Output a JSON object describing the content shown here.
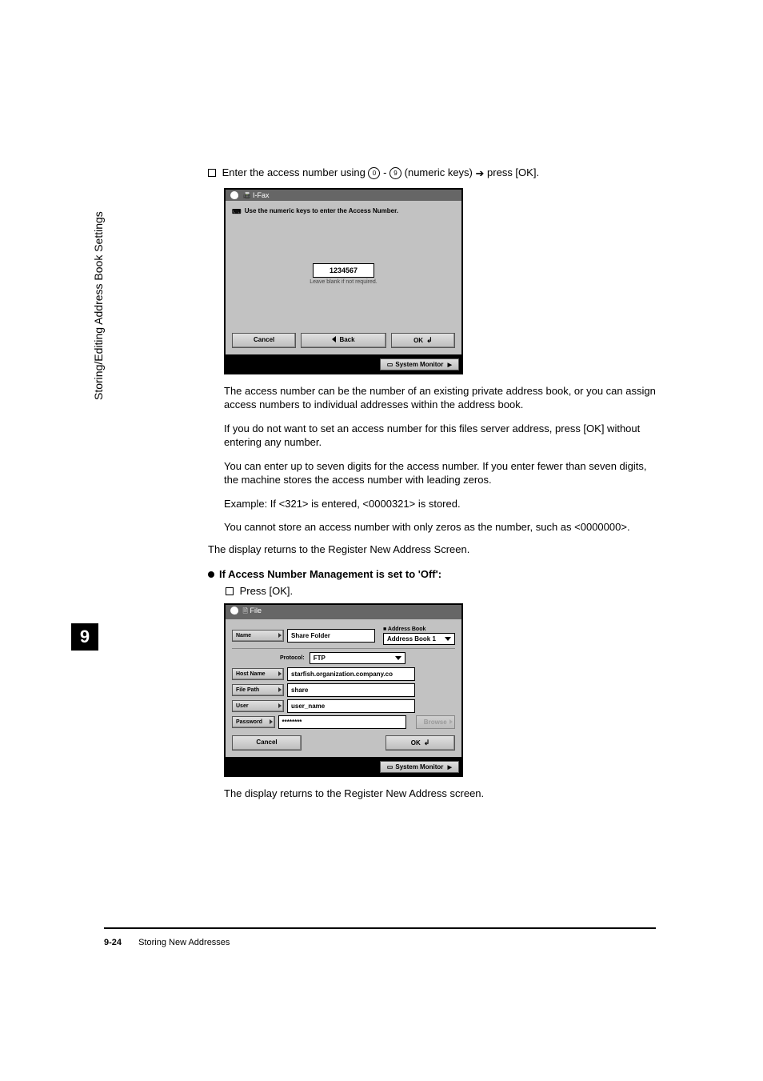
{
  "sideTab": "Storing/Editing Address Book Settings",
  "chapterNumber": "9",
  "intro": {
    "prefix": "Enter the access number using ",
    "key0": "0",
    "key9": "9",
    "mid": " (numeric keys) ",
    "suffix": " press [OK]."
  },
  "ss1": {
    "title": "I-Fax",
    "instruction": "Use the numeric keys to enter the Access Number.",
    "value": "1234567",
    "note": "Leave blank if not required.",
    "cancel": "Cancel",
    "back": "Back",
    "ok": "OK",
    "sysMonitor": "System Monitor"
  },
  "paras": {
    "p1": "The access number can be the number of an existing private address book, or you can assign access numbers to individual addresses within the address book.",
    "p2": "If you do not want to set an access number for this files server address, press [OK] without entering any number.",
    "p3": "You can enter up to seven digits for the access number. If you enter fewer than seven digits, the machine stores the access number with leading zeros.",
    "p4": "Example: If <321> is entered, <0000321> is stored.",
    "p5": "You cannot store an access number with only zeros as the number, such as <0000000>.",
    "p6": "The display returns to the Register New Address Screen."
  },
  "section2": {
    "heading": "If Access Number Management is set to 'Off':",
    "pressOk": "Press [OK]."
  },
  "ss2": {
    "title": "File",
    "nameLabel": "Name",
    "nameValue": "Share Folder",
    "abLabel": "Address Book",
    "abValue": "Address Book 1",
    "protocolLabel": "Protocol:",
    "protocolValue": "FTP",
    "hostLabel": "Host Name",
    "hostValue": "starfish.organization.company.co",
    "pathLabel": "File Path",
    "pathValue": "share",
    "userLabel": "User",
    "userValue": "user_name",
    "pwdLabel": "Password",
    "pwdValue": "********",
    "browse": "Browse",
    "cancel": "Cancel",
    "ok": "OK",
    "sysMonitor": "System Monitor"
  },
  "afterSS2": "The display returns to the Register New Address screen.",
  "footer": {
    "pageNum": "9-24",
    "section": "Storing New Addresses"
  }
}
